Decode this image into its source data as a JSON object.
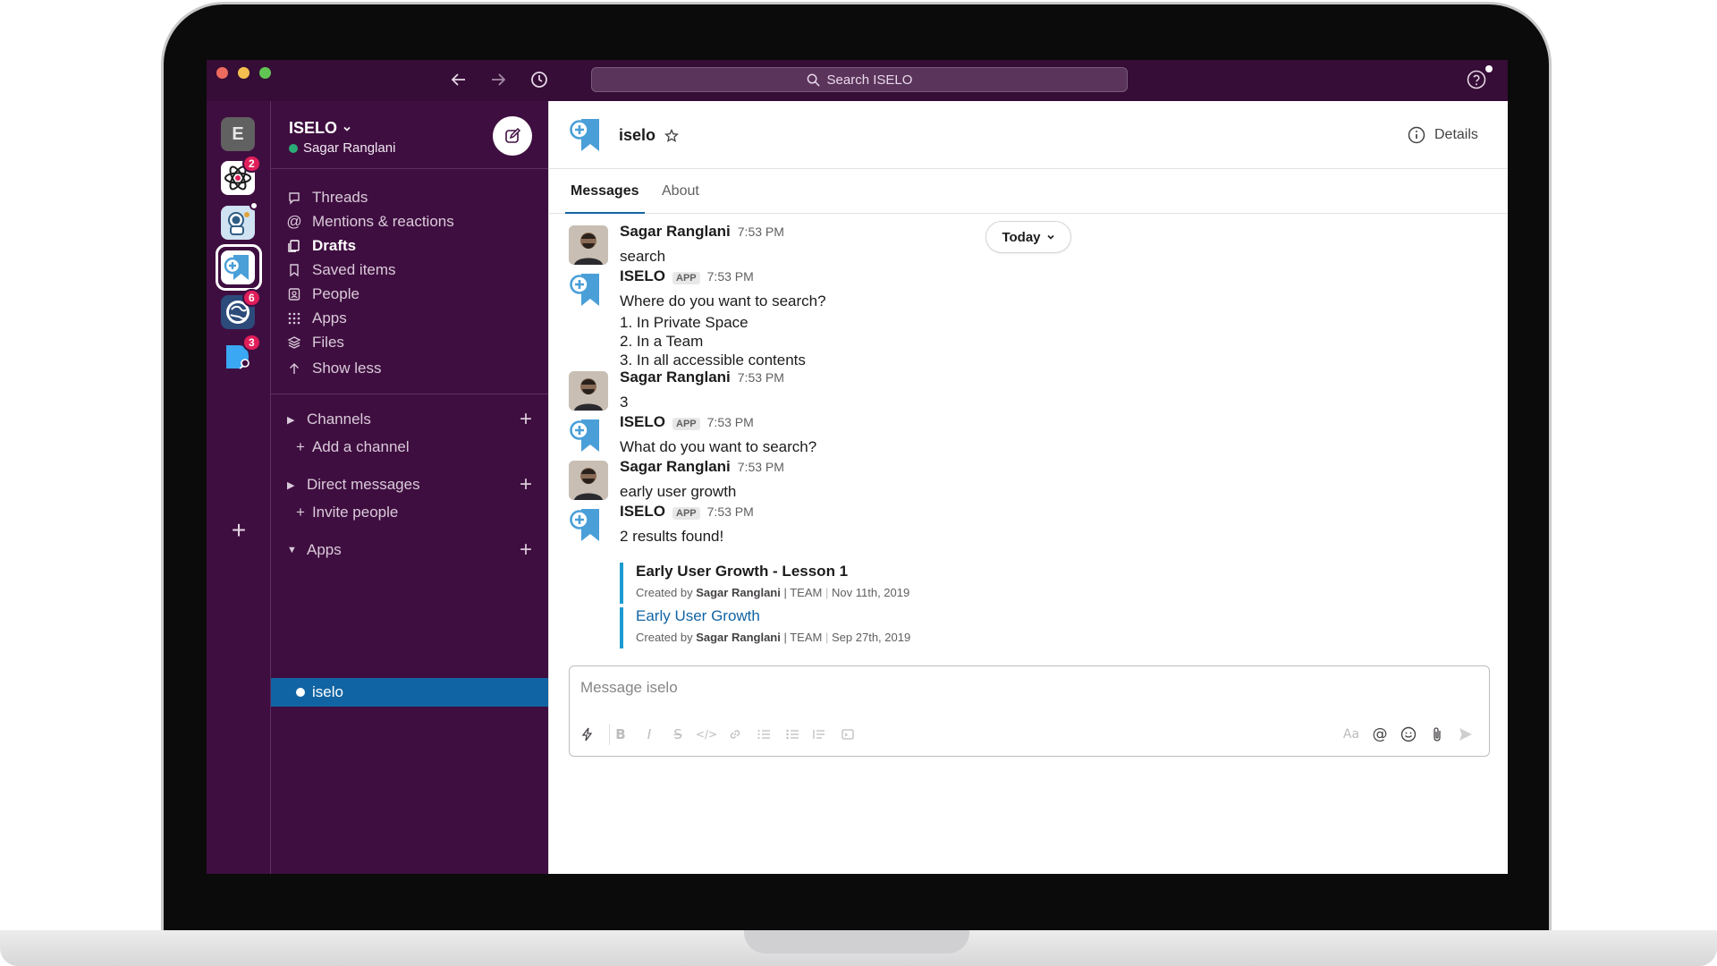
{
  "search": {
    "placeholder": "Search ISELO"
  },
  "workspaces": [
    {
      "name": "E",
      "badge": ""
    },
    {
      "name": "atom-workspace",
      "badge": "2"
    },
    {
      "name": "astronaut-workspace",
      "badge": ""
    },
    {
      "name": "iselo-workspace",
      "badge": ""
    },
    {
      "name": "globe-workspace",
      "badge": "6"
    },
    {
      "name": "blue-workspace",
      "badge": "3"
    }
  ],
  "team": {
    "name": "ISELO",
    "user": "Sagar Ranglani"
  },
  "nav": {
    "threads": "Threads",
    "mentions": "Mentions & reactions",
    "drafts": "Drafts",
    "saved": "Saved items",
    "people": "People",
    "apps": "Apps",
    "files": "Files",
    "show_less": "Show less"
  },
  "sections": {
    "channels": "Channels",
    "add_channel": "Add a channel",
    "direct_messages": "Direct messages",
    "invite_people": "Invite people",
    "apps": "Apps",
    "active_app": "iselo"
  },
  "channel": {
    "name": "iselo",
    "details": "Details"
  },
  "tabs": {
    "messages": "Messages",
    "about": "About"
  },
  "today_label": "Today",
  "messages": [
    {
      "author": "Sagar Ranglani",
      "time": "7:53 PM",
      "lines": [
        "search"
      ]
    },
    {
      "author": "ISELO",
      "tag": "APP",
      "time": "7:53 PM",
      "lines": [
        "Where do you want to search?",
        "1. In Private Space",
        "2. In a Team",
        "3. In all accessible contents"
      ]
    },
    {
      "author": "Sagar Ranglani",
      "time": "7:53 PM",
      "lines": [
        "3"
      ]
    },
    {
      "author": "ISELO",
      "tag": "APP",
      "time": "7:53 PM",
      "lines": [
        "What do you want to search?"
      ]
    },
    {
      "author": "Sagar Ranglani",
      "time": "7:53 PM",
      "lines": [
        "early user growth"
      ]
    },
    {
      "author": "ISELO",
      "tag": "APP",
      "time": "7:53 PM",
      "lines": [
        "2 results found!"
      ]
    }
  ],
  "results": [
    {
      "title": "Early User Growth - Lesson 1",
      "created_by_label": "Created by",
      "author": "Sagar Ranglani",
      "scope": "| TEAM",
      "date": "Nov 11th, 2019"
    },
    {
      "title": "Early User Growth",
      "created_by_label": "Created by",
      "author": "Sagar Ranglani",
      "scope": "| TEAM",
      "date": "Sep 27th, 2019"
    }
  ],
  "composer": {
    "placeholder": "Message iselo"
  },
  "colors": {
    "aubergine": "#3f0e40",
    "titlebar": "#350d36",
    "active_blue": "#1164a3",
    "link_blue": "#1264a3",
    "badge_red": "#e01e5a",
    "presence_green": "#2bac76"
  }
}
